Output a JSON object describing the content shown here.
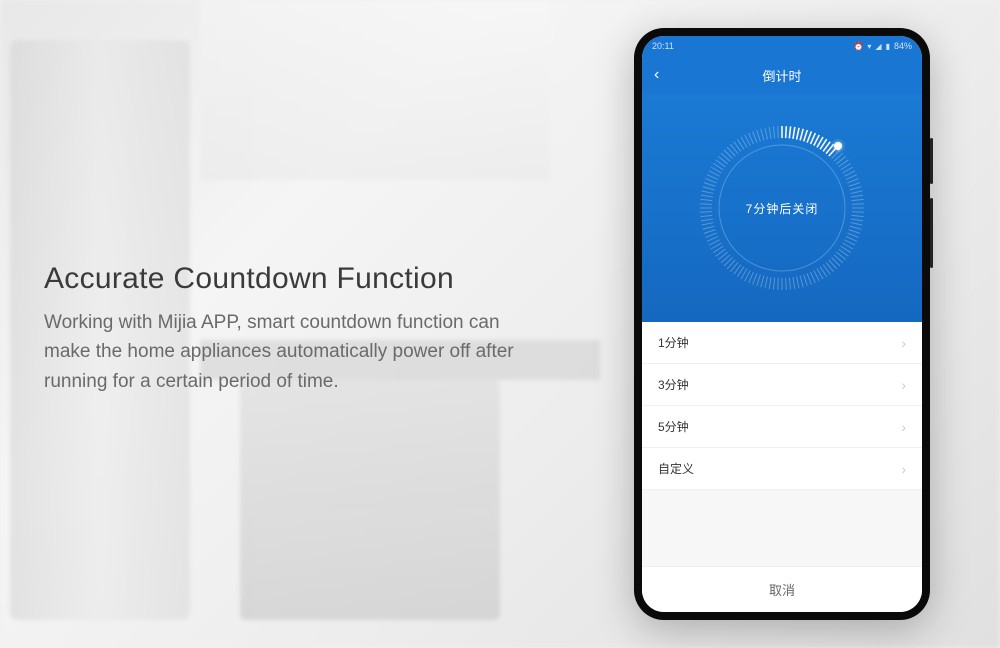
{
  "marketing": {
    "heading": "Accurate Countdown Function",
    "body": "Working with Mijia APP, smart countdown function can make the home appliances automatically power off after running for a certain period of time."
  },
  "phone": {
    "status": {
      "time": "20:11",
      "battery": "84%",
      "icons": "⋯ ⏰ ▾ ▲"
    },
    "header": {
      "back": "‹",
      "title": "倒计时"
    },
    "dial": {
      "label": "7分钟后关闭",
      "progress_deg": 42
    },
    "options": [
      {
        "label": "1分钟"
      },
      {
        "label": "3分钟"
      },
      {
        "label": "5分钟"
      },
      {
        "label": "自定义"
      }
    ],
    "cancel": "取消"
  }
}
